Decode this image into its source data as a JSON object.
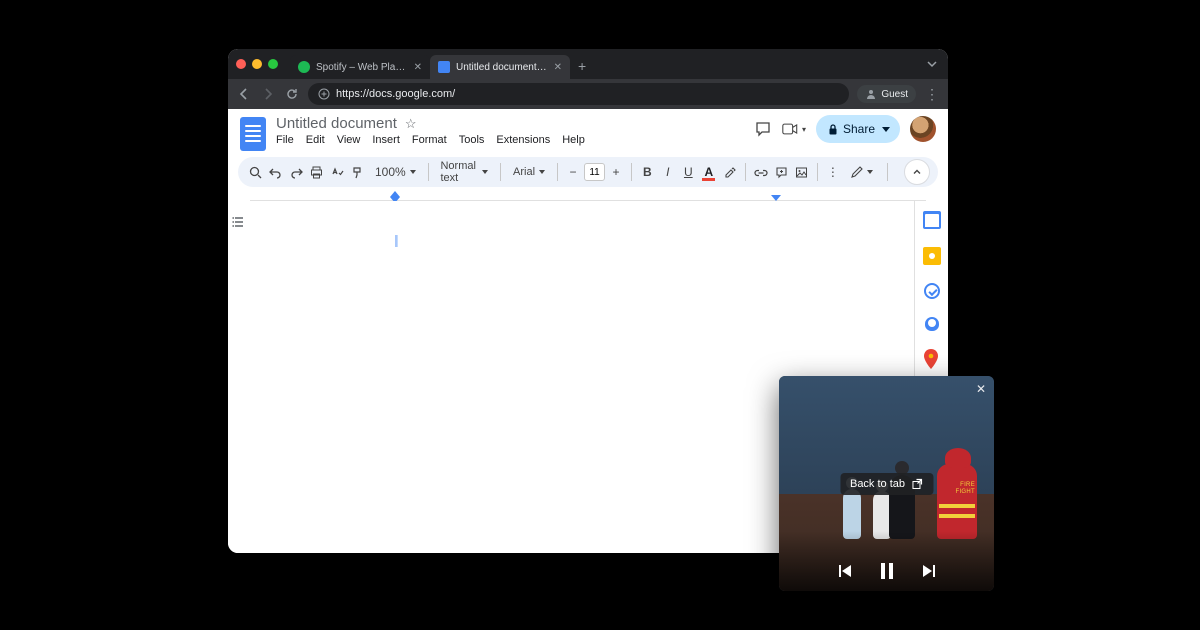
{
  "browser": {
    "tabs": [
      {
        "label": "Spotify – Web Player: Music f",
        "favicon_color": "#1db954"
      },
      {
        "label": "Untitled document - Google D",
        "favicon_color": "#4285f4"
      }
    ],
    "url": "https://docs.google.com/",
    "guest_label": "Guest"
  },
  "docs": {
    "title": "Untitled document",
    "menus": [
      "File",
      "Edit",
      "View",
      "Insert",
      "Format",
      "Tools",
      "Extensions",
      "Help"
    ],
    "share_label": "Share",
    "zoom": "100%",
    "style_name": "Normal text",
    "font_name": "Arial",
    "font_size": "11"
  },
  "pip": {
    "back_label": "Back to tab"
  }
}
